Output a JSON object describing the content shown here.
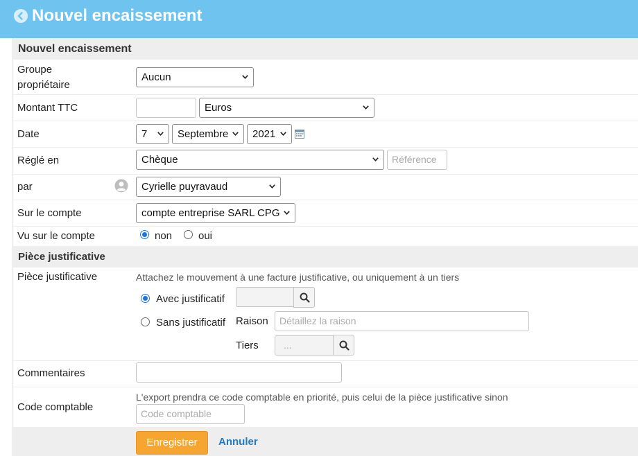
{
  "header": {
    "title": "Nouvel encaissement"
  },
  "section_main": {
    "title": "Nouvel encaissement"
  },
  "groupe": {
    "label_line1": "Groupe",
    "label_line2": "propriétaire",
    "value": "Aucun"
  },
  "montant": {
    "label": "Montant TTC",
    "amount": "",
    "currency": "Euros"
  },
  "date": {
    "label": "Date",
    "day": "7",
    "month": "Septembre",
    "year": "2021"
  },
  "regle": {
    "label": "Réglé en",
    "value": "Chèque",
    "reference_placeholder": "Référence"
  },
  "par": {
    "label": "par",
    "value": "Cyrielle puyravaud"
  },
  "compte": {
    "label": "Sur le compte",
    "value": "compte entreprise SARL CPG"
  },
  "vu": {
    "label": "Vu sur le compte",
    "option_non": "non",
    "option_oui": "oui",
    "selected": "non"
  },
  "section_piece": {
    "title": "Pièce justificative"
  },
  "piece": {
    "label": "Pièce justificative",
    "hint": "Attachez le mouvement à une facture justificative, ou uniquement à un tiers",
    "option_avec": "Avec justificatif",
    "option_sans": "Sans justificatif",
    "selected": "avec",
    "raison_label": "Raison",
    "raison_placeholder": "Détaillez la raison",
    "tiers_label": "Tiers",
    "tiers_placeholder": "..."
  },
  "commentaires": {
    "label": "Commentaires",
    "value": ""
  },
  "code": {
    "label": "Code comptable",
    "hint": "L'export prendra ce code comptable en priorité, puis celui de la pièce justificative sinon",
    "placeholder": "Code comptable"
  },
  "actions": {
    "save_label": "Enregistrer",
    "cancel_label": "Annuler"
  },
  "colors": {
    "header_bg": "#6ec3ef",
    "save_bg": "#f7a531",
    "cancel_link": "#1f7bc4",
    "radio_accent": "#1a73e8"
  }
}
